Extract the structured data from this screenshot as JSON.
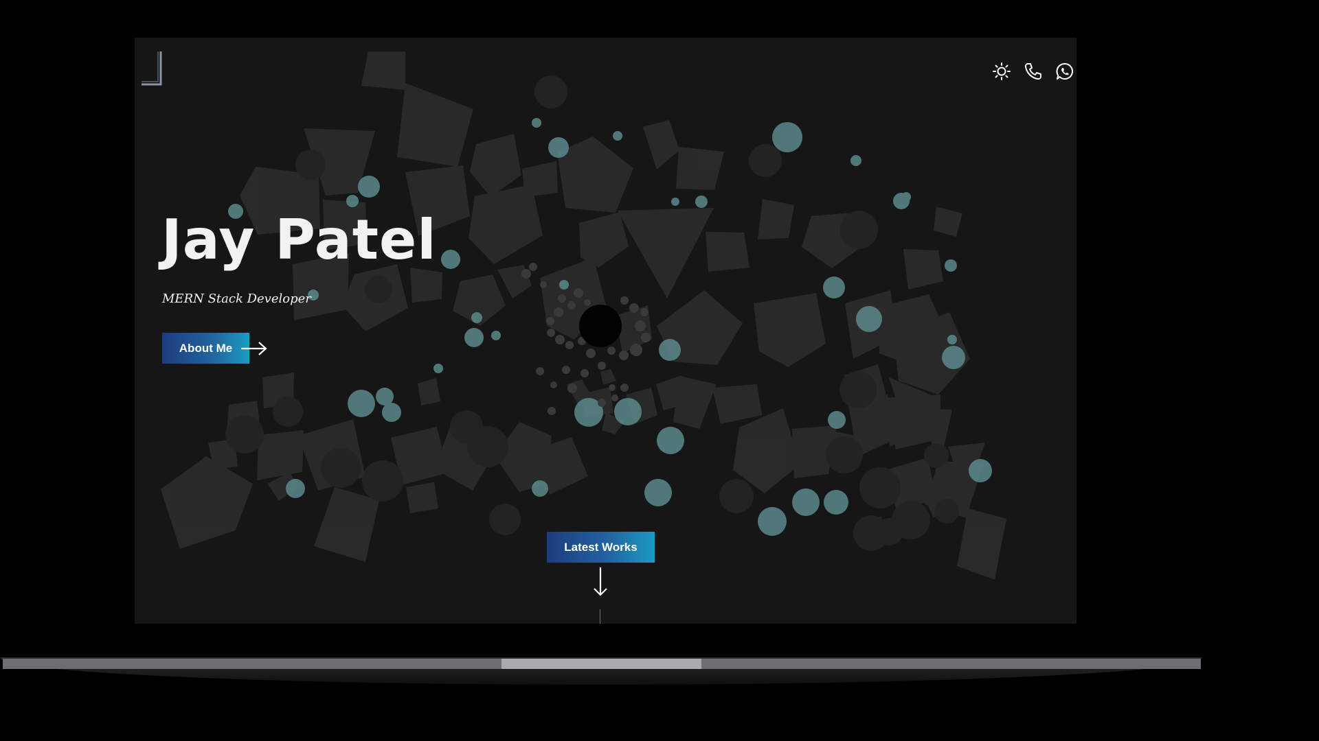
{
  "header": {
    "logo_icon": "j-logo-icon",
    "icons": [
      "sun-icon",
      "phone-icon",
      "whatsapp-icon"
    ]
  },
  "hero": {
    "name": "Jay Patel",
    "role": "MERN Stack Developer",
    "about_label": "About Me"
  },
  "works": {
    "label": "Latest Works"
  },
  "colors": {
    "background": "#161616",
    "button_start": "#1d3c7e",
    "button_end": "#1a9cc0",
    "accent_circles": "#5b8a8c"
  }
}
